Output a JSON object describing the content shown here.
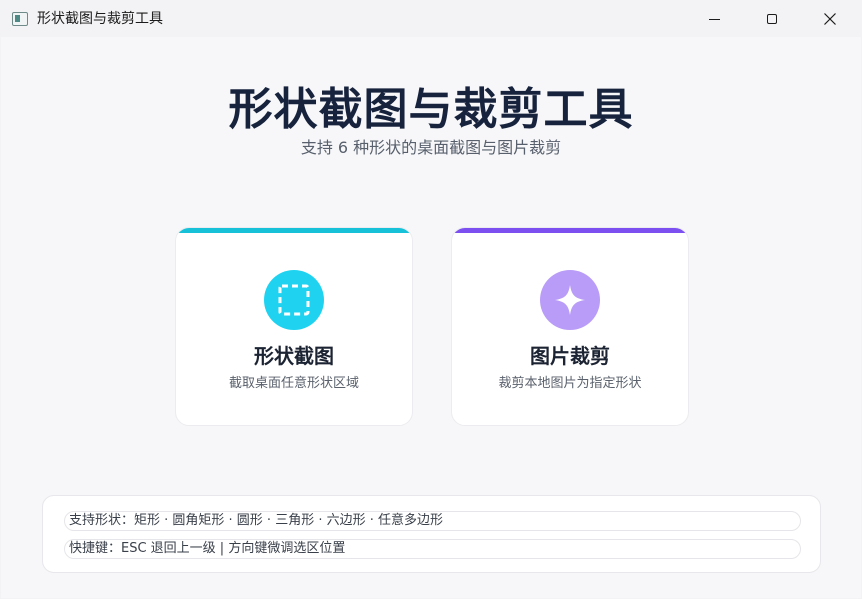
{
  "window": {
    "title": "形状截图与裁剪工具"
  },
  "header": {
    "title": "形状截图与裁剪工具",
    "subtitle": "支持 6 种形状的桌面截图与图片裁剪"
  },
  "cards": [
    {
      "title": "形状截图",
      "description": "截取桌面任意形状区域",
      "accent_color": "#17c1d8",
      "icon_bg": "#1fd3f0",
      "icon": "dashed-selection-icon"
    },
    {
      "title": "图片裁剪",
      "description": "裁剪本地图片为指定形状",
      "accent_color": "#7c4ff0",
      "icon_bg": "#b99cf7",
      "icon": "sparkle-icon"
    }
  ],
  "info": {
    "shapes": "支持形状：矩形 · 圆角矩形 · 圆形 · 三角形 · 六边形 · 任意多边形",
    "shortcuts": "快捷键：ESC 退回上一级 | 方向键微调选区位置"
  }
}
